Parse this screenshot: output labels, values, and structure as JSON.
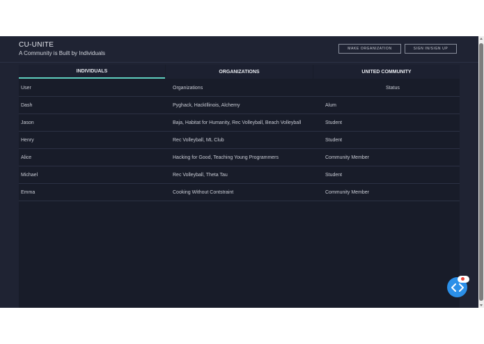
{
  "header": {
    "title": "CU-UNITE",
    "subtitle": "A Community is Built by Individuals",
    "make_org_label": "MAKE ORGANIZATION",
    "sign_in_label": "SIGN IN/SIGN UP"
  },
  "tabs": [
    {
      "label": "INDIVIDUALS"
    },
    {
      "label": "ORGANIZATIONS"
    },
    {
      "label": "UNITED COMMUNITY"
    }
  ],
  "table": {
    "columns": [
      "User",
      "Organizations",
      "Status"
    ],
    "rows": [
      [
        "Dash",
        "Pyghack, HackIllinois, Alchemy",
        "Alum"
      ],
      [
        "Jason",
        "Baja, Habitat for Humanity, Rec Volleyball, Beach Volleyball",
        "Student"
      ],
      [
        "Henry",
        "Rec Volleyball, ML Club",
        "Student"
      ],
      [
        "Alice",
        "Hacking for Good, Teaching Young Programmers",
        "Community Member"
      ],
      [
        "Michael",
        "Rec Volleyball, Theta Tau",
        "Student"
      ],
      [
        "Emma",
        "Cooking Without Contstraint",
        "Community Member"
      ]
    ]
  },
  "colors": {
    "background": "#1f2333",
    "panel": "#181c29",
    "active_tab_underline": "#5fd0c0",
    "fab": "#2b8fe8",
    "fab_badge_dot": "#e8453c"
  },
  "icons": {
    "fab": "code-brackets-icon"
  }
}
